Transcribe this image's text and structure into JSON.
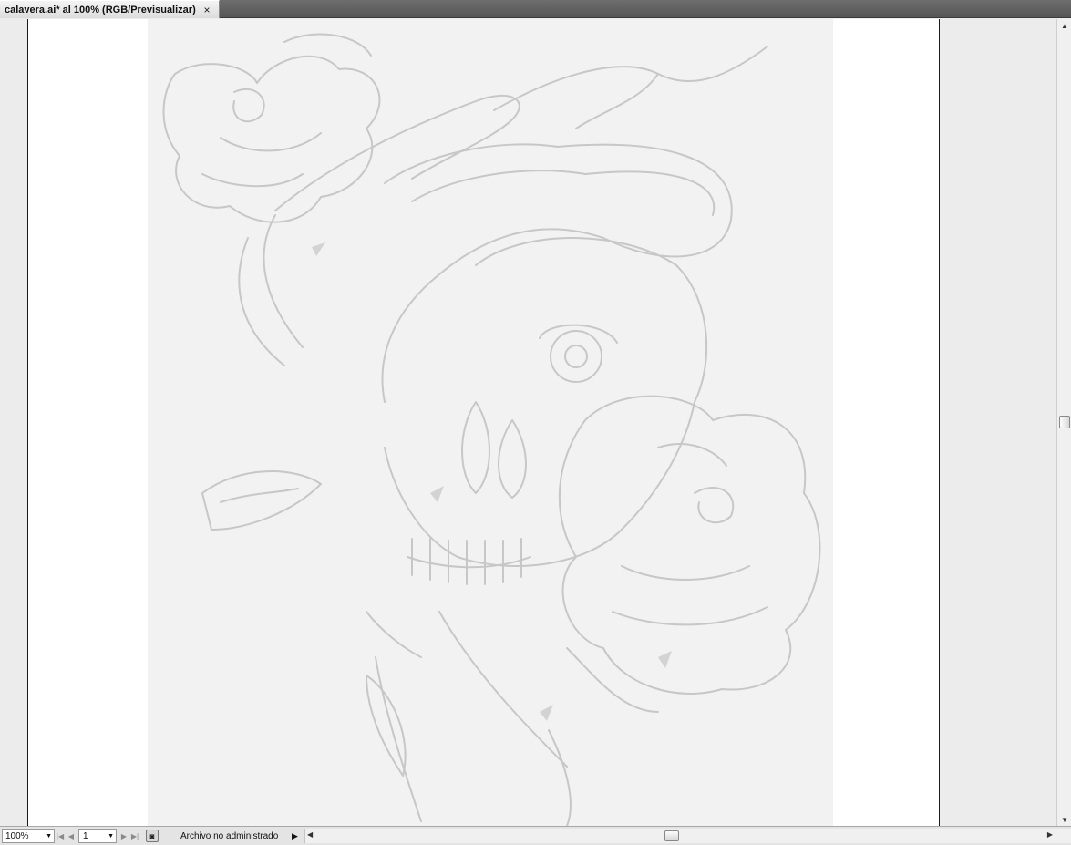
{
  "document_tab": {
    "title": "calavera.ai* al 100% (RGB/Previsualizar)",
    "close_glyph": "×"
  },
  "artboard": {
    "placed_image": "skull-snake-roses-sketch"
  },
  "statusbar": {
    "zoom": "100%",
    "page": "1",
    "status_text": "Archivo no administrado",
    "menu_glyph": "▶"
  },
  "scroll": {
    "vertical_position": 0.5,
    "horizontal_position": 0.5
  },
  "icons": {
    "first": "first-page-icon",
    "prev": "previous-page-icon",
    "next": "next-page-icon",
    "last": "last-page-icon",
    "dropdown": "dropdown-arrow-icon",
    "status": "document-status-icon"
  },
  "colors": {
    "sketch_line": "#c7c7c7",
    "paper": "#f2f2f2",
    "artboard": "#ffffff",
    "canvas": "#ececec"
  }
}
